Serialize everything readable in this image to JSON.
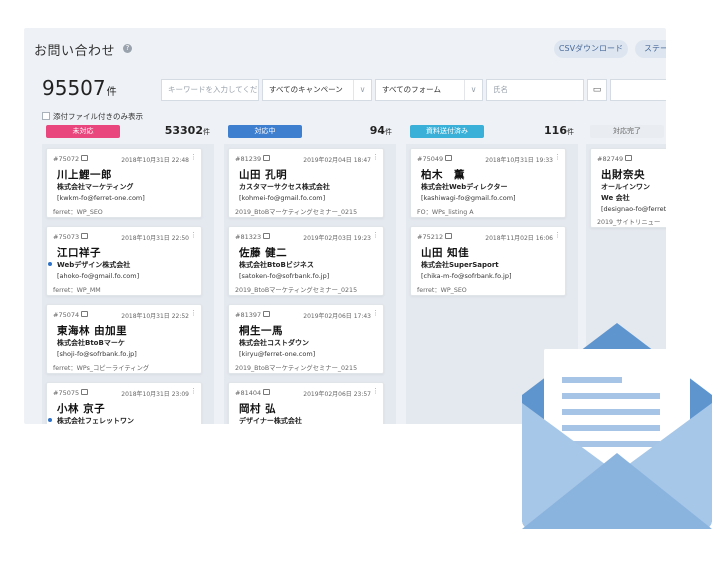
{
  "header": {
    "title": "お問い合わせ",
    "help_icon": "?",
    "csv_button": "CSVダウンロード",
    "status_button": "ステータ"
  },
  "summary": {
    "count": "95507",
    "unit": "件"
  },
  "filters": {
    "keyword_placeholder": "キーワードを入力してくだ",
    "campaign": "すべてのキャンペーン",
    "form": "すべてのフォーム",
    "assignee_placeholder": "氏名",
    "calendar_icon": "calendar-icon"
  },
  "attach_filter": {
    "label": "添付ファイル付きのみ表示"
  },
  "columns": [
    {
      "status": "未対応",
      "color": "#e8467c",
      "count": "53302",
      "unit": "件",
      "cards": [
        {
          "id": "#75072",
          "date": "2018年10月31日 22:48",
          "name": "川上鯉一郎",
          "company": "株式会社マーケティング",
          "email": "[kwkm-fo@ferret-one.com]",
          "tag": "ferret：WP_SEO",
          "dot": false
        },
        {
          "id": "#75073",
          "date": "2018年10月31日 22:50",
          "name": "江口祥子",
          "company": "Webデザイン株式会社",
          "email": "[ahoko-fo@gmail.fo.com]",
          "tag": "ferret：WP_MM",
          "dot": true
        },
        {
          "id": "#75074",
          "date": "2018年10月31日 22:52",
          "name": "東海林 由加里",
          "company": "株式会社BtoBマーケ",
          "email": "[shoji-fo@sofrbank.fo.jp]",
          "tag": "ferret：WPs_コピーライティング",
          "dot": false
        },
        {
          "id": "#75075",
          "date": "2018年10月31日 23:09",
          "name": "小林 京子",
          "company": "株式会社フェレットワン",
          "email": "",
          "tag": "",
          "dot": true
        }
      ]
    },
    {
      "status": "対応中",
      "color": "#3f7fd0",
      "count": "94",
      "unit": "件",
      "cards": [
        {
          "id": "#81239",
          "date": "2019年02月04日 18:47",
          "name": "山田 孔明",
          "company": "カスタマーサクセス株式会社",
          "email": "[kohmei-fo@gmail.fo.com]",
          "tag": "2019_BtoBマーケティングセミナー_0215",
          "dot": false
        },
        {
          "id": "#81323",
          "date": "2019年02月03日 19:23",
          "name": "佐藤 健二",
          "company": "株式会社BtoBビジネス",
          "email": "[satoken-fo@sofrbank.fo.jp]",
          "tag": "2019_BtoBマーケティングセミナー_0215",
          "dot": false
        },
        {
          "id": "#81397",
          "date": "2019年02月06日 17:43",
          "name": "桐生一馬",
          "company": "株式会社コストダウン",
          "email": "[kiryu@ferret-one.com]",
          "tag": "2019_BtoBマーケティングセミナー_0215",
          "dot": false
        },
        {
          "id": "#81404",
          "date": "2019年02月06日 23:57",
          "name": "岡村 弘",
          "company": "デザイナー株式会社",
          "email": "",
          "tag": "",
          "dot": false
        }
      ]
    },
    {
      "status": "資料送付済み",
      "color": "#3ab0d8",
      "count": "116",
      "unit": "件",
      "cards": [
        {
          "id": "#75049",
          "date": "2018年10月31日 19:33",
          "name": "柏木　薫",
          "company": "株式会社Webディレクター",
          "email": "[kashiwagi-fo@gmail.fo.com]",
          "tag": "FO：WPs_listing A",
          "dot": false
        },
        {
          "id": "#75212",
          "date": "2018年11月02日 16:06",
          "name": "山田 知佳",
          "company": "株式会社SuperSaport",
          "email": "[chika-m-fo@sofrbank.fo.jp]",
          "tag": "ferret：WP_SEO",
          "dot": false
        }
      ]
    },
    {
      "status": "対応完了",
      "color": "#e9edf1",
      "count": "",
      "unit": "",
      "cards": [
        {
          "id": "#82749",
          "date": "",
          "name": "出財奈央",
          "company": "オールインワンWe 会社",
          "email": "[designao-fo@ferret",
          "tag": "2019_サイトリニュー",
          "dot": false
        }
      ]
    }
  ],
  "decoration": {
    "envelope_icon": "envelope-icon"
  }
}
